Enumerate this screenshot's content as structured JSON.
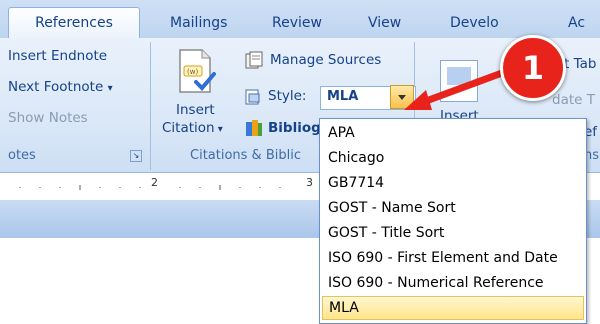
{
  "tabs": [
    "References",
    "Mailings",
    "Review",
    "View",
    "Develo",
    "Ac"
  ],
  "footnotes_group": {
    "insert_endnote": "Insert Endnote",
    "next_footnote": "Next Footnote",
    "show_notes": "Show Notes",
    "label": "otes"
  },
  "citations_group": {
    "insert_citation_line1": "Insert",
    "insert_citation_line2": "Citation",
    "manage_sources": "Manage Sources",
    "style_label": "Style:",
    "style_value": "MLA",
    "bibliography": "Bibliog",
    "label": "Citations & Biblic"
  },
  "right_group": {
    "item1": "t Tab",
    "item2": "date T",
    "item3": "Insert",
    "item4": "ef",
    "label": "ns"
  },
  "ruler": {
    "numbers": [
      "2",
      "3"
    ]
  },
  "callout": {
    "number": "1"
  },
  "style_options": [
    "APA",
    "Chicago",
    "GB7714",
    "GOST - Name Sort",
    "GOST - Title Sort",
    "ISO 690 - First Element and Date",
    "ISO 690 - Numerical Reference",
    "MLA"
  ],
  "selected_option": "MLA",
  "colors": {
    "accent_red": "#e8231b",
    "ribbon_blue": "#dbe8f7",
    "highlight": "#ffe68a"
  }
}
